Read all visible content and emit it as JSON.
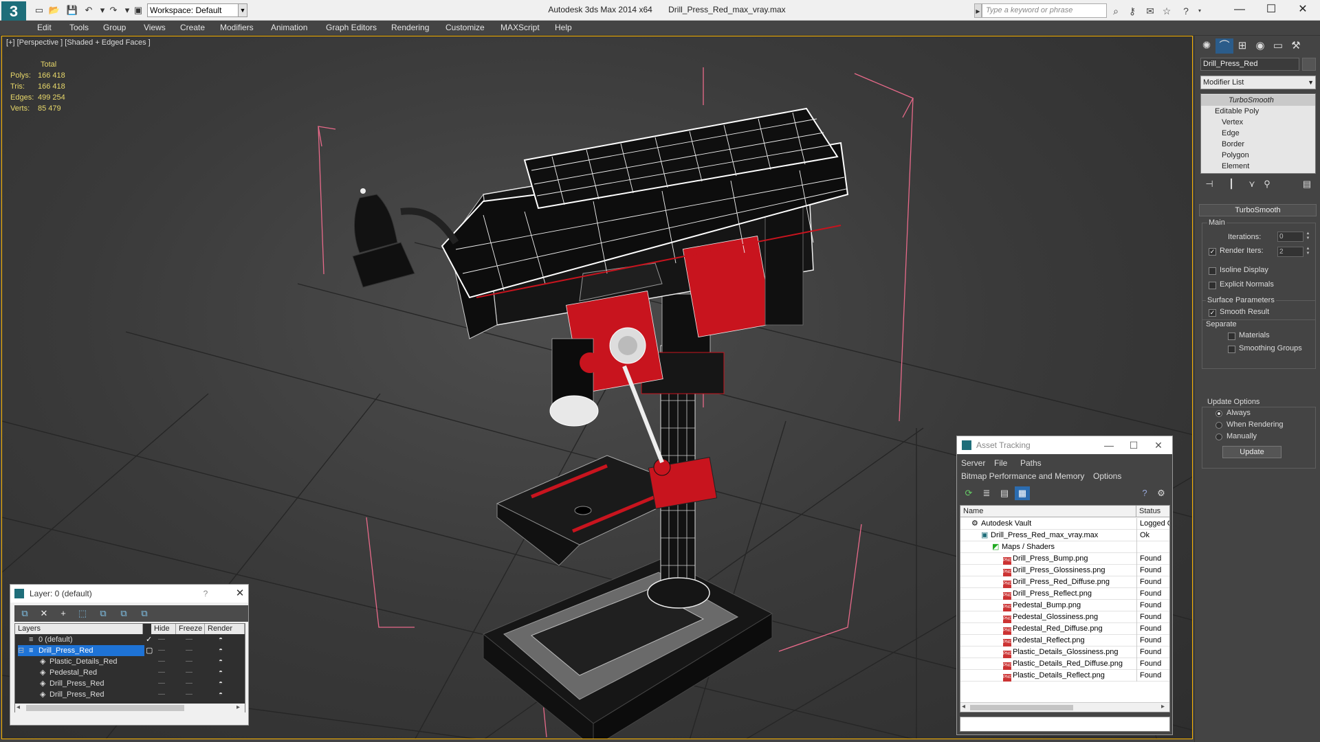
{
  "titlebar": {
    "logo": "3",
    "workspace": "Workspace: Default",
    "app_title": "Autodesk 3ds Max  2014 x64",
    "file_name": "Drill_Press_Red_max_vray.max",
    "search_placeholder": "Type a keyword or phrase"
  },
  "menu": [
    "Edit",
    "Tools",
    "Group",
    "Views",
    "Create",
    "Modifiers",
    "Animation",
    "Graph Editors",
    "Rendering",
    "Customize",
    "MAXScript",
    "Help"
  ],
  "viewport": {
    "label": "[+] [Perspective ] [Shaded + Edged Faces ]",
    "stats": {
      "header": "Total",
      "rows": [
        {
          "label": "Polys:",
          "value": "166 418"
        },
        {
          "label": "Tris:",
          "value": "166 418"
        },
        {
          "label": "Edges:",
          "value": "499 254"
        },
        {
          "label": "Verts:",
          "value": "85 479"
        }
      ]
    }
  },
  "command_panel": {
    "object_name": "Drill_Press_Red",
    "modifier_list": "Modifier List",
    "stack": [
      "TurboSmooth",
      "Editable Poly",
      "Vertex",
      "Edge",
      "Border",
      "Polygon",
      "Element"
    ],
    "rollout_title": "TurboSmooth",
    "main_group": "Main",
    "iterations_label": "Iterations:",
    "iterations_value": "0",
    "render_iters_label": "Render Iters:",
    "render_iters_value": "2",
    "isoline_display": "Isoline Display",
    "explicit_normals": "Explicit Normals",
    "surface_params": "Surface Parameters",
    "smooth_result": "Smooth Result",
    "separate": "Separate",
    "materials": "Materials",
    "smoothing_groups": "Smoothing Groups",
    "update_options": "Update Options",
    "always": "Always",
    "when_rendering": "When Rendering",
    "manually": "Manually",
    "update_button": "Update"
  },
  "layer_dialog": {
    "title": "Layer: 0 (default)",
    "help": "?",
    "columns": [
      "Layers",
      "Hide",
      "Freeze",
      "Render"
    ],
    "rows": [
      "0 (default)",
      "Drill_Press_Red",
      "Plastic_Details_Red",
      "Pedestal_Red",
      "Drill_Press_Red",
      "Drill_Press_Red"
    ]
  },
  "asset_tracking": {
    "title": "Asset Tracking",
    "menu1": [
      "Server",
      "File",
      "Paths"
    ],
    "menu2": [
      "Bitmap Performance and Memory",
      "Options"
    ],
    "columns": [
      "Name",
      "Status"
    ],
    "rows": [
      {
        "name": "Autodesk Vault",
        "status": "Logged O"
      },
      {
        "name": "Drill_Press_Red_max_vray.max",
        "status": "Ok"
      },
      {
        "name": "Maps / Shaders",
        "status": ""
      },
      {
        "name": "Drill_Press_Bump.png",
        "status": "Found"
      },
      {
        "name": "Drill_Press_Glossiness.png",
        "status": "Found"
      },
      {
        "name": "Drill_Press_Red_Diffuse.png",
        "status": "Found"
      },
      {
        "name": "Drill_Press_Reflect.png",
        "status": "Found"
      },
      {
        "name": "Pedestal_Bump.png",
        "status": "Found"
      },
      {
        "name": "Pedestal_Glossiness.png",
        "status": "Found"
      },
      {
        "name": "Pedestal_Red_Diffuse.png",
        "status": "Found"
      },
      {
        "name": "Pedestal_Reflect.png",
        "status": "Found"
      },
      {
        "name": "Plastic_Details_Glossiness.png",
        "status": "Found"
      },
      {
        "name": "Plastic_Details_Red_Diffuse.png",
        "status": "Found"
      },
      {
        "name": "Plastic_Details_Reflect.png",
        "status": "Found"
      }
    ]
  },
  "colors": {
    "viewport_border": "#ffb700",
    "stats_text": "#e8d86a",
    "bbox_lines": "#e86a8a",
    "selection": "#1e73d6",
    "model_red": "#c8141e"
  }
}
